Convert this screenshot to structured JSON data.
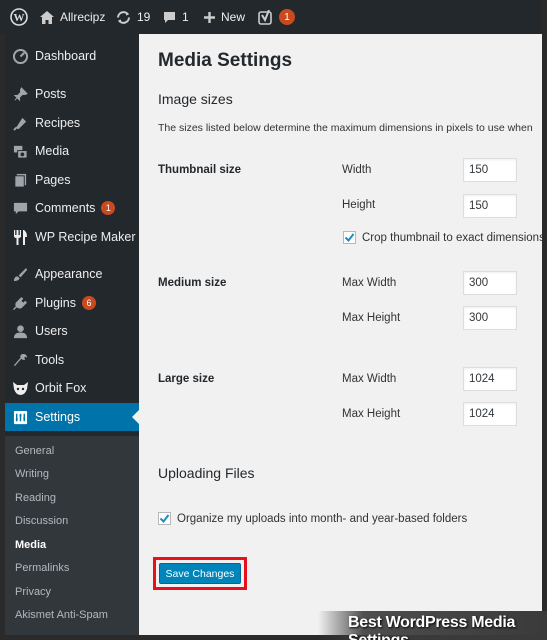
{
  "admin_bar": {
    "site_name": "Allrecipz",
    "updates_count": "19",
    "comments_count": "1",
    "new_label": "New",
    "yoast_count": "1"
  },
  "sidebar": {
    "items": [
      {
        "label": "Dashboard",
        "icon": "dashboard-icon"
      },
      {
        "label": "Posts",
        "icon": "pin-icon"
      },
      {
        "label": "Recipes",
        "icon": "recipe-icon"
      },
      {
        "label": "Media",
        "icon": "media-icon"
      },
      {
        "label": "Pages",
        "icon": "pages-icon"
      },
      {
        "label": "Comments",
        "icon": "comments-icon",
        "badge": "1"
      },
      {
        "label": "WP Recipe Maker",
        "icon": "fork-knife-icon"
      },
      {
        "label": "Appearance",
        "icon": "brush-icon"
      },
      {
        "label": "Plugins",
        "icon": "plugin-icon",
        "badge": "6"
      },
      {
        "label": "Users",
        "icon": "users-icon"
      },
      {
        "label": "Tools",
        "icon": "wrench-icon"
      },
      {
        "label": "Orbit Fox",
        "icon": "fox-icon"
      },
      {
        "label": "Settings",
        "icon": "settings-icon"
      }
    ],
    "submenu": [
      "General",
      "Writing",
      "Reading",
      "Discussion",
      "Media",
      "Permalinks",
      "Privacy",
      "Akismet Anti-Spam"
    ]
  },
  "main": {
    "title": "Media Settings",
    "image_sizes_heading": "Image sizes",
    "image_sizes_desc": "The sizes listed below determine the maximum dimensions in pixels to use when",
    "thumbnail": {
      "label": "Thumbnail size",
      "width_label": "Width",
      "width": "150",
      "height_label": "Height",
      "height": "150",
      "crop_label": "Crop thumbnail to exact dimensions"
    },
    "medium": {
      "label": "Medium size",
      "max_width_label": "Max Width",
      "max_width": "300",
      "max_height_label": "Max Height",
      "max_height": "300"
    },
    "large": {
      "label": "Large size",
      "max_width_label": "Max Width",
      "max_width": "1024",
      "max_height_label": "Max Height",
      "max_height": "1024"
    },
    "uploading_heading": "Uploading Files",
    "organize_label": "Organize my uploads into month- and year-based folders",
    "save_label": "Save Changes"
  },
  "caption": "Best WordPress Media Settings",
  "colors": {
    "admin_bar": "#23282d",
    "active_menu": "#0073aa",
    "button": "#0085ba",
    "highlight_border": "#e8101a",
    "badge": "#ca4a1f"
  }
}
